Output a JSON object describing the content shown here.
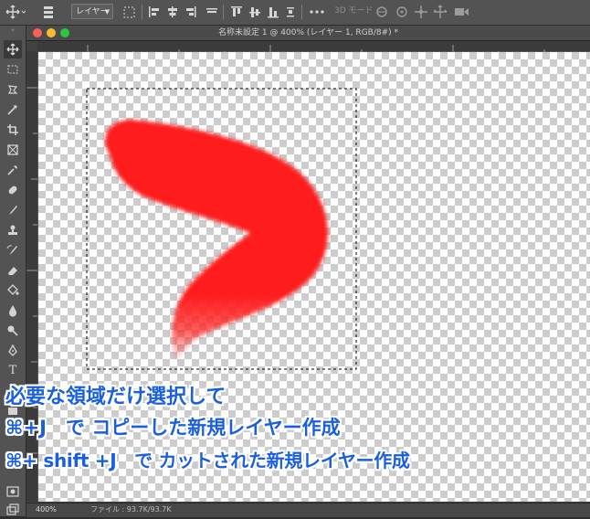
{
  "options_bar": {
    "layer_select": "レイヤー",
    "mode_3d": "3D モード"
  },
  "document": {
    "title": "名称未設定 1 @ 400% (レイヤー 1, RGB/8#) *",
    "zoom": "400%",
    "file_info": "ファイル : 93.7K/93.7K",
    "ruler_top_ticks": [
      "",
      "",
      ""
    ],
    "ruler_left_ticks": []
  },
  "caption": {
    "line1": "必要な領域だけ選択して",
    "line2": "⌘+J　で コピーした新規レイヤー作成",
    "line3": "⌘+ shift +J　で カットされた新規レイヤー作成"
  },
  "colors": {
    "stroke": "#ff1f1f",
    "caption": "#1a5fe0",
    "traffic_close": "#fc5f57",
    "traffic_min": "#fdbc2e",
    "traffic_max": "#28c840"
  }
}
